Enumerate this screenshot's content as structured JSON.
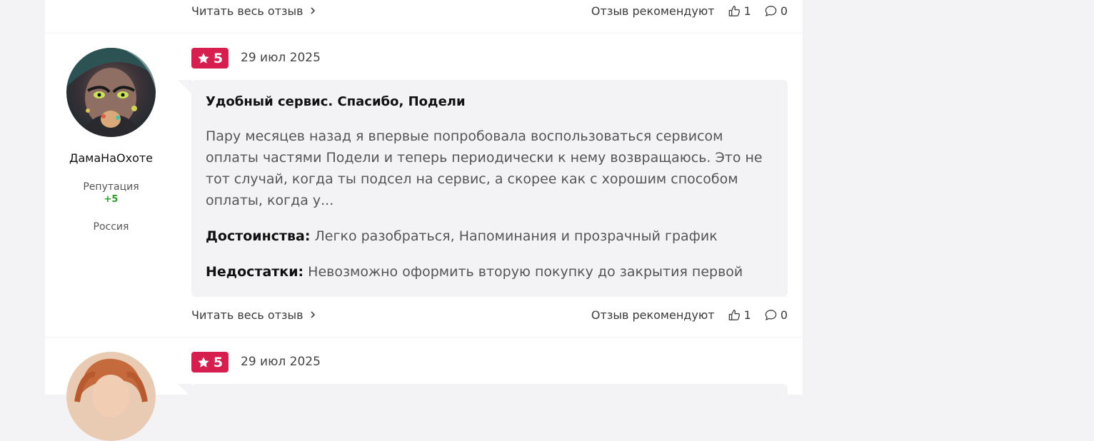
{
  "prev_review": {
    "read_more": "Читать весь отзыв",
    "recommend_label": "Отзыв рекомендуют",
    "likes": "1",
    "comments": "0"
  },
  "review": {
    "author": {
      "name": "ДамаНаОхоте",
      "reputation_label": "Репутация",
      "reputation_value": "+5",
      "country": "Россия"
    },
    "rating": "5",
    "date": "29 июл 2025",
    "title": "Удобный сервис. Спасибо, Подели",
    "text": "Пару месяцев назад я впервые попробовала воспользоваться сервисом оплаты частями Подели и теперь периодически к нему возвращаюсь. Это не тот случай, когда ты подсел на сервис, а скорее как с хорошим способом оплаты, когда у...",
    "pros_label": "Достоинства:",
    "pros": "Легко разобраться, Напоминания и прозрачный график",
    "cons_label": "Недостатки:",
    "cons": "Невозможно оформить вторую покупку до закрытия первой",
    "read_more": "Читать весь отзыв",
    "recommend_label": "Отзыв рекомендуют",
    "likes": "1",
    "comments": "0"
  },
  "next_review": {
    "rating": "5",
    "date": "29 июл 2025"
  },
  "colors": {
    "rating_badge": "#d61f4f",
    "reputation": "#2a9d2a",
    "bubble_bg": "#f3f3f6"
  }
}
